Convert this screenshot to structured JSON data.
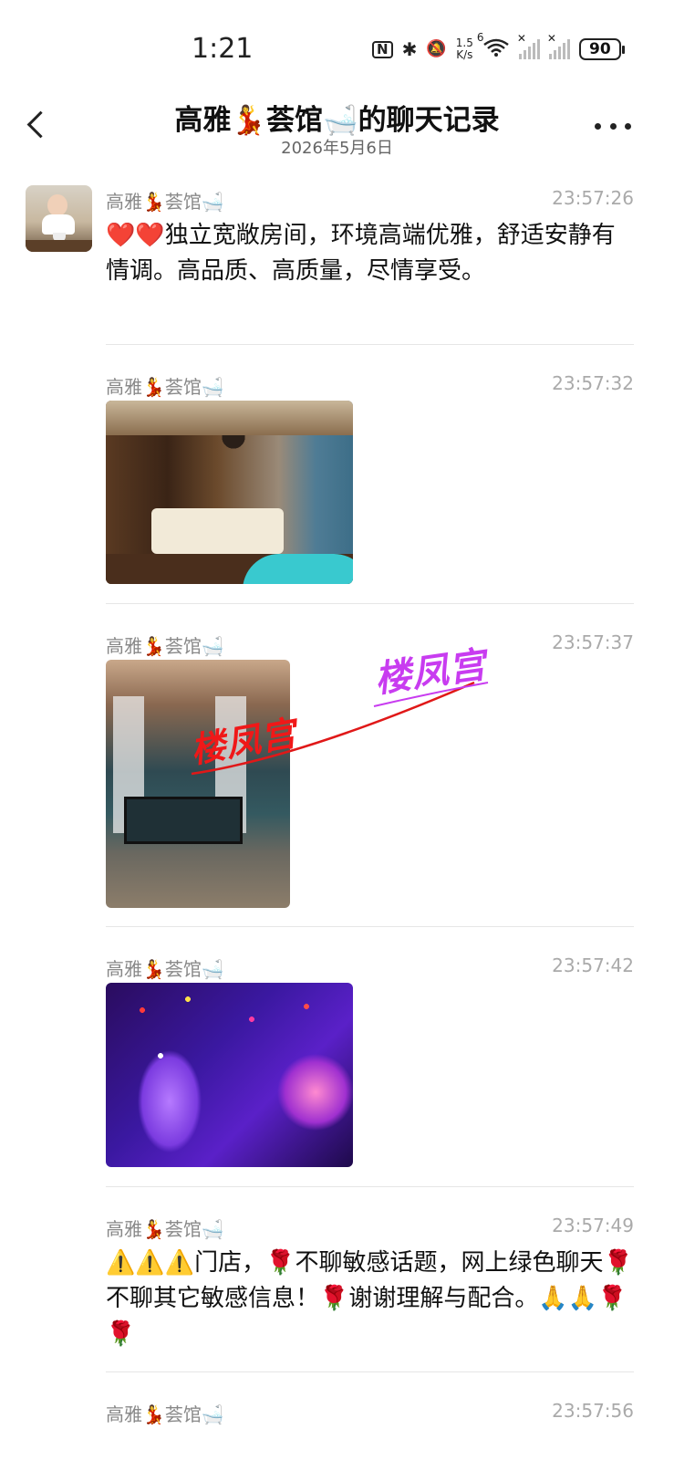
{
  "status_bar": {
    "time": "1:21",
    "nfc": "N",
    "bluetooth": "✱",
    "mute": "🔕",
    "net_speed_value": "1.5",
    "net_speed_unit": "K/s",
    "wifi_label": "6",
    "battery": "90"
  },
  "header": {
    "title": "高雅💃荟馆🛁的聊天记录",
    "date": "2026年5月6日"
  },
  "messages": [
    {
      "sender": "高雅💃荟馆🛁",
      "time": "23:57:26",
      "text": "❤️❤️独立宽敞房间，环境高端优雅，舒适安静有情调。高品质、高质量，尽情享受。"
    },
    {
      "sender": "高雅💃荟馆🛁",
      "time": "23:57:32",
      "image": "spa-room-photo"
    },
    {
      "sender": "高雅💃荟馆🛁",
      "time": "23:57:37",
      "image": "canopy-bed-photo",
      "watermark_1": "楼凤宫",
      "watermark_2": "楼凤宫"
    },
    {
      "sender": "高雅💃荟馆🛁",
      "time": "23:57:42",
      "image": "disco-light-room-photo"
    },
    {
      "sender": "高雅💃荟馆🛁",
      "time": "23:57:49",
      "text": "⚠️⚠️⚠️门店，🌹不聊敏感话题，网上绿色聊天🌹不聊其它敏感信息！🌹谢谢理解与配合。🙏🙏🌹🌹"
    },
    {
      "sender": "高雅💃荟馆🛁",
      "time": "23:57:56"
    }
  ]
}
